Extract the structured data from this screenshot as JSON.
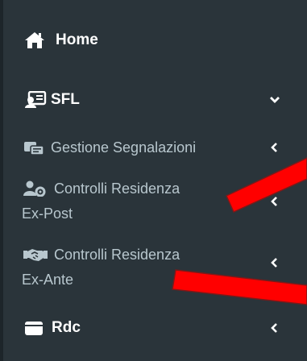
{
  "sidebar": {
    "home": {
      "label": "Home",
      "icon": "home-icon"
    },
    "sfl": {
      "label": "SFL",
      "icon": "id-card-icon",
      "expanded": true
    },
    "submenu": [
      {
        "line1": "Gestione Segnalazioni",
        "line2": "",
        "icon": "reports-icon"
      },
      {
        "line1": "Controlli Residenza",
        "line2": "Ex-Post",
        "icon": "user-gear-icon"
      },
      {
        "line1": "Controlli Residenza",
        "line2": "Ex-Ante",
        "icon": "handshake-icon"
      }
    ],
    "rdc": {
      "label": "Rdc",
      "icon": "wallet-icon"
    }
  },
  "colors": {
    "sidebar_bg": "#2a343a",
    "text_primary": "#ffffff",
    "text_secondary": "#b8c7ce",
    "annotation_red": "#ff0000"
  }
}
